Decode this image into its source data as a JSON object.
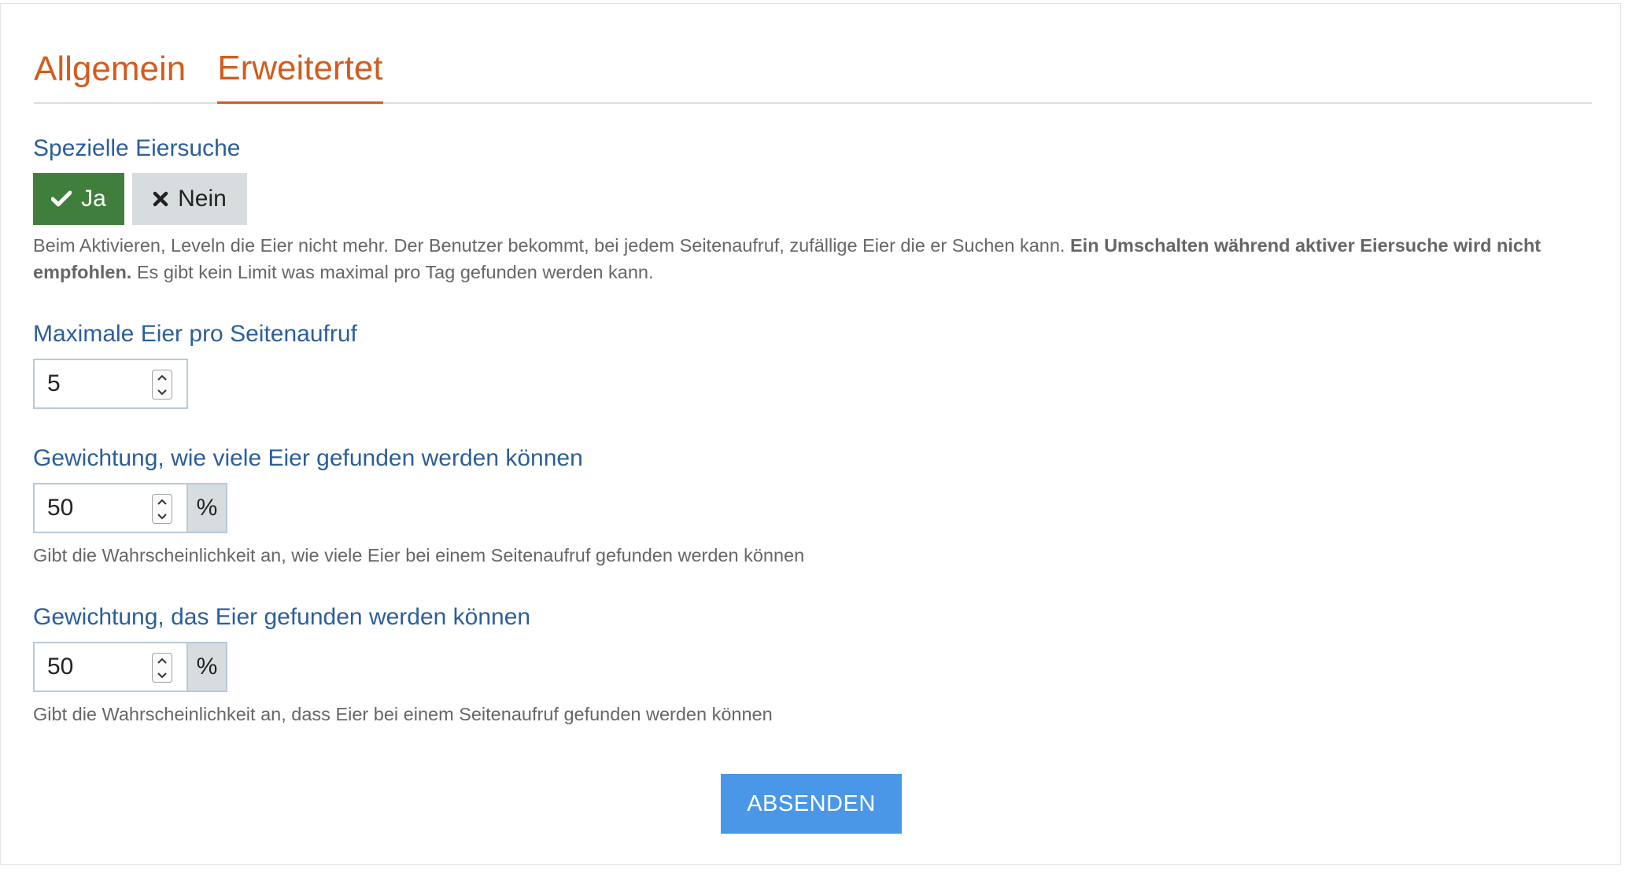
{
  "tabs": [
    {
      "label": "Allgemein",
      "active": false
    },
    {
      "label": "Erweitertet",
      "active": true
    }
  ],
  "special_search": {
    "label": "Spezielle Eiersuche",
    "yes_label": "Ja",
    "no_label": "Nein",
    "selected": "yes",
    "yes_icon": "check-icon",
    "no_icon": "close-icon",
    "help_part1": "Beim Aktivieren, Leveln die Eier nicht mehr. Der Benutzer bekommt, bei jedem Seitenaufruf, zufällige Eier die er Suchen kann. ",
    "help_bold": "Ein Umschalten während aktiver Eiersuche wird nicht empfohlen.",
    "help_part2": " Es gibt kein Limit was maximal pro Tag gefunden werden kann."
  },
  "max_eggs": {
    "label": "Maximale Eier pro Seitenaufruf",
    "value": "5"
  },
  "weight_count": {
    "label": "Gewichtung, wie viele Eier gefunden werden können",
    "value": "50",
    "unit": "%",
    "help": "Gibt die Wahrscheinlichkeit an, wie viele Eier bei einem Seitenaufruf gefunden werden können"
  },
  "weight_found": {
    "label": "Gewichtung, das Eier gefunden werden können",
    "value": "50",
    "unit": "%",
    "help": "Gibt die Wahrscheinlichkeit an, dass Eier bei einem Seitenaufruf gefunden werden können"
  },
  "submit_label": "ABSENDEN",
  "colors": {
    "tab_accent": "#d35c1c",
    "label_blue": "#2c5e9b",
    "yes_green": "#3f7f3b",
    "no_gray": "#d7dcdf",
    "submit_blue": "#4a97e8"
  }
}
